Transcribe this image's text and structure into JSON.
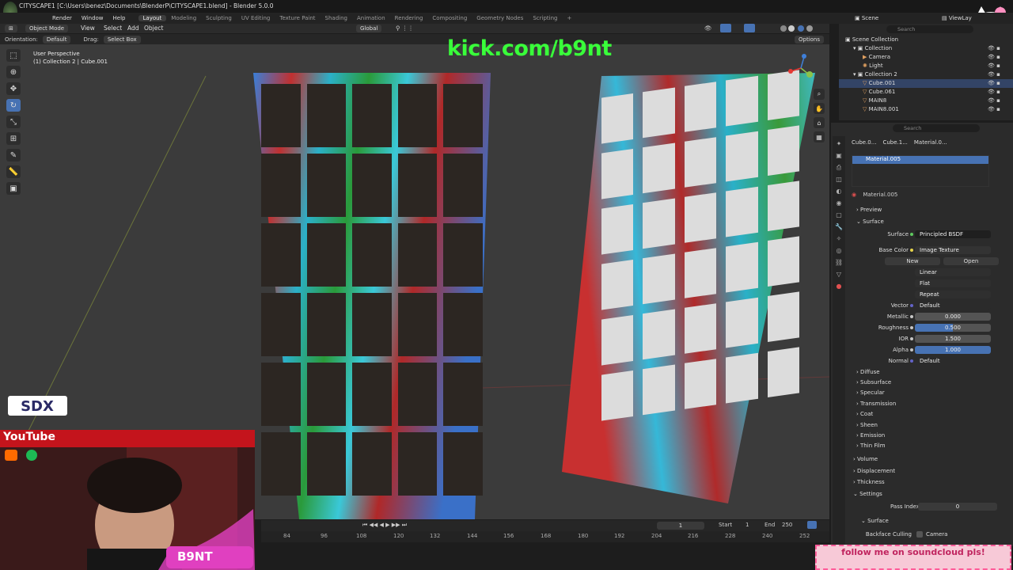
{
  "window": {
    "title": "CITYSCAPE1 [C:\\Users\\benez\\Documents\\BlenderP\\CITYSCAPE1.blend] - Blender 5.0.0"
  },
  "menu": {
    "items": [
      "Render",
      "Window",
      "Help"
    ]
  },
  "workspaces": {
    "active": "Layout",
    "tabs": [
      "Layout",
      "Modeling",
      "Sculpting",
      "UV Editing",
      "Texture Paint",
      "Shading",
      "Animation",
      "Rendering",
      "Compositing",
      "Geometry Nodes",
      "Scripting"
    ]
  },
  "scene": {
    "label": "Scene",
    "viewlayer": "ViewLay"
  },
  "viewport_header": {
    "mode": "Object Mode",
    "menus": [
      "View",
      "Select",
      "Add",
      "Object"
    ],
    "transform": "Global",
    "options": "Options"
  },
  "tool_settings": {
    "orientation_label": "Orientation:",
    "orientation_value": "Default",
    "drag_label": "Drag:",
    "drag_value": "Select Box"
  },
  "viewport": {
    "perspective": "User Perspective",
    "collection_info": "(1) Collection 2 | Cube.001"
  },
  "overlay_text": {
    "watermark": "kick.com/b9nt",
    "youtube": "YouTube",
    "follow": "follow me on soundcloud pls!",
    "sdx": "SDX",
    "logo": "B9NT"
  },
  "outliner": {
    "search_placeholder": "Search",
    "items": [
      {
        "name": "Scene Collection",
        "icon": "collection-icon"
      },
      {
        "name": "Collection",
        "icon": "collection-icon"
      },
      {
        "name": "Camera",
        "icon": "camera-icon"
      },
      {
        "name": "Light",
        "icon": "light-icon"
      },
      {
        "name": "Collection 2",
        "icon": "collection-icon"
      },
      {
        "name": "Cube.001",
        "icon": "mesh-icon"
      },
      {
        "name": "Cube.061",
        "icon": "mesh-icon"
      },
      {
        "name": "MAIN8",
        "icon": "mesh-icon"
      },
      {
        "name": "MAIN8.001",
        "icon": "mesh-icon"
      }
    ]
  },
  "properties": {
    "search_placeholder": "Search",
    "breadcrumb": [
      "Cube.0...",
      "Cube.1...",
      "Material.0..."
    ],
    "slot": "Material.005",
    "material_name": "Material.005",
    "sections": {
      "preview": "Preview",
      "surface": "Surface"
    },
    "surface": {
      "label": "Surface",
      "value": "Principled BSDF"
    },
    "base_color": {
      "label": "Base Color",
      "value": "Image Texture"
    },
    "image_buttons": {
      "new": "New",
      "open": "Open"
    },
    "interpolation": "Linear",
    "projection": "Flat",
    "extension": "Repeat",
    "vector": {
      "label": "Vector",
      "value": "Default"
    },
    "metallic": {
      "label": "Metallic",
      "value": "0.000"
    },
    "roughness": {
      "label": "Roughness",
      "value": "0.500"
    },
    "ior": {
      "label": "IOR",
      "value": "1.500"
    },
    "alpha": {
      "label": "Alpha",
      "value": "1.000"
    },
    "normal": {
      "label": "Normal",
      "value": "Default"
    },
    "subsections": [
      "Diffuse",
      "Subsurface",
      "Specular",
      "Transmission",
      "Coat",
      "Sheen",
      "Emission",
      "Thin Film"
    ],
    "more_sections": [
      "Volume",
      "Displacement",
      "Thickness",
      "Settings"
    ],
    "pass_index": {
      "label": "Pass Index",
      "value": "0"
    },
    "surface2": "Surface",
    "backface": {
      "label": "Backface Culling",
      "value": "Camera"
    }
  },
  "timeline": {
    "start_label": "Start",
    "start": "1",
    "end_label": "End",
    "end": "250",
    "current": "1",
    "ticks": [
      "84",
      "96",
      "108",
      "120",
      "132",
      "144",
      "156",
      "168",
      "180",
      "192",
      "204",
      "216",
      "228",
      "240",
      "252"
    ]
  },
  "colors": {
    "accent": "#4772b3",
    "watermark": "#39ff3a",
    "youtube_red": "#c4141c"
  }
}
